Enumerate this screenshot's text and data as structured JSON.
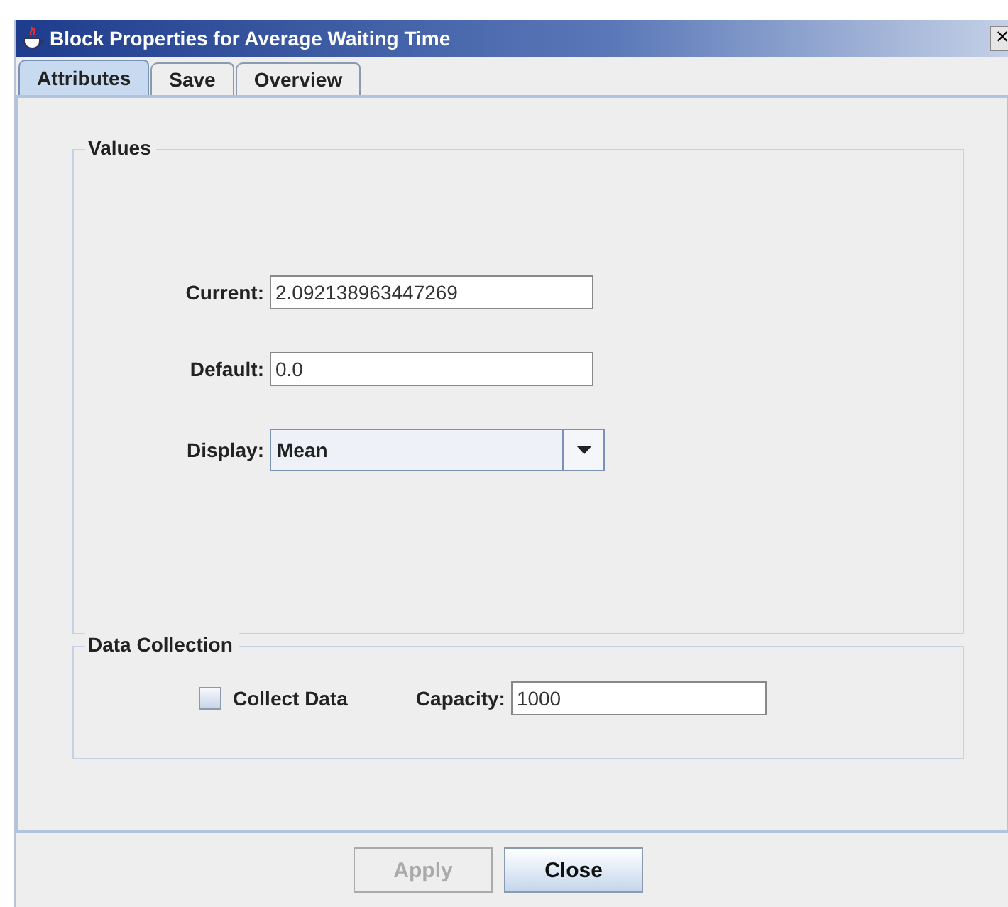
{
  "window": {
    "title": "Block Properties for Average Waiting Time",
    "close": "×"
  },
  "tabs": [
    {
      "label": "Attributes",
      "selected": true
    },
    {
      "label": "Save",
      "selected": false
    },
    {
      "label": "Overview",
      "selected": false
    }
  ],
  "values_group": {
    "title": "Values",
    "fields": [
      {
        "kind": "text",
        "label": "Current:",
        "value": "2.092138963447269"
      },
      {
        "kind": "text",
        "label": "Default:",
        "value": "0.0"
      },
      {
        "kind": "select",
        "label": "Display:",
        "value": "Mean"
      }
    ]
  },
  "data_collection": {
    "title": "Data Collection",
    "checkbox": {
      "label": "Collect Data",
      "checked": false
    },
    "capacity": {
      "label": "Capacity:",
      "value": "1000"
    }
  },
  "buttons": [
    {
      "label": "Apply",
      "disabled": true
    },
    {
      "label": "Close",
      "disabled": false
    }
  ]
}
